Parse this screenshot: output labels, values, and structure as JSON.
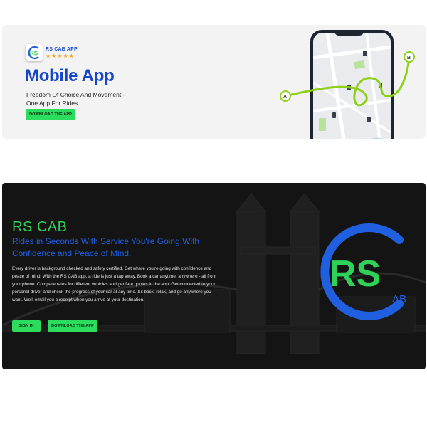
{
  "banner": {
    "app_name": "RS CAB APP",
    "rating": 5,
    "title": "Mobile App",
    "tagline": "Freedom Of Choice And Movement - One App For Rides",
    "download_label": "DOWNLOAD THE APP",
    "map_point_a": "A",
    "map_point_b": "B",
    "logo_text": "RS"
  },
  "hero": {
    "title": "RS CAB",
    "subtitle": "Rides in Seconds With Service You're Going With Confidence and Peace of Mind.",
    "body": "Every driver is background checked and safety certified. Get where you're going with confidence and peace of mind. With the RS CAB app, a ride is just a tap away. Book a car anytime, anywhere - all from your phone. Compare rates for different vehicles and get fare quotes in the app. Get connected to your personal driver and check the progress of your car at any time. Sit back, relax, and go anywhere you want. We'll email you a receipt when you arrive at your destination.",
    "signin_label": "SIGN IN",
    "download_label": "DOWNLOAD THE APP",
    "logo_letters": "RS",
    "logo_suffix": "AB"
  },
  "colors": {
    "brand_blue": "#1747c9",
    "brand_green": "#2cdc5c",
    "route_green": "#8fd11a",
    "star": "#f2a100"
  }
}
